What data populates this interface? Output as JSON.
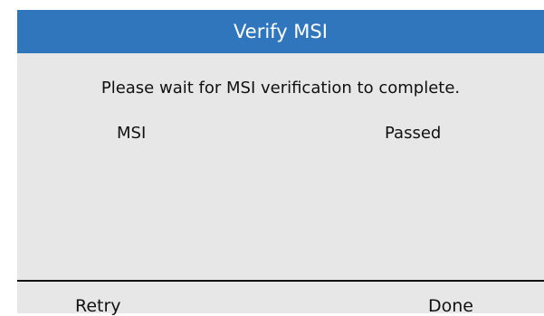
{
  "dialog": {
    "title": "Verify MSI",
    "message": "Please wait for MSI verification to complete."
  },
  "results": [
    {
      "label": "MSI",
      "status": "Passed"
    }
  ],
  "softkeys": {
    "left": "Retry",
    "right": "Done"
  },
  "colors": {
    "title_bar": "#2f76bc",
    "background": "#e7e7e7"
  }
}
